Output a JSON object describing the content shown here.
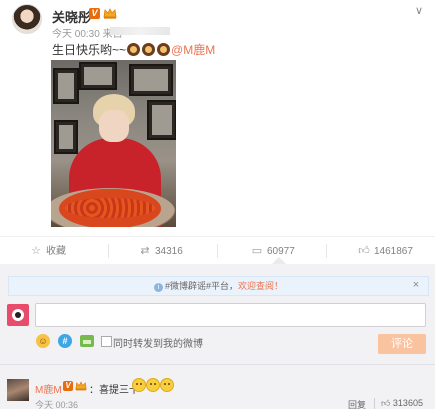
{
  "post": {
    "author": "关晓彤",
    "v_badge": "V",
    "time": "今天 00:30 来自",
    "text_prefix": "生日快乐哟~~",
    "mention": "@M鹿M",
    "more_icon": "chevron-down-icon"
  },
  "actions": {
    "favorite_label": "收藏",
    "repost_count": "34316",
    "comment_count": "60977",
    "like_count": "1461867"
  },
  "comment_box": {
    "notice_prefix": "#微博辟谣#平台，",
    "notice_highlight": "欢迎查阅！",
    "notice_close": "×",
    "repost_label": "同时转发到我的微博",
    "submit_label": "评论",
    "emoji_icon": "☺",
    "topic_icon": "#"
  },
  "reply": {
    "name": "M鹿M",
    "v_badge": "V",
    "text": "：喜提三十",
    "time": "今天 00:36",
    "reply_label": "回复",
    "like_count": "313605"
  },
  "colors": {
    "accent_orange": "#eb7350",
    "verified_orange": "#e86b0c",
    "comment_bg": "#f2f2f5"
  }
}
